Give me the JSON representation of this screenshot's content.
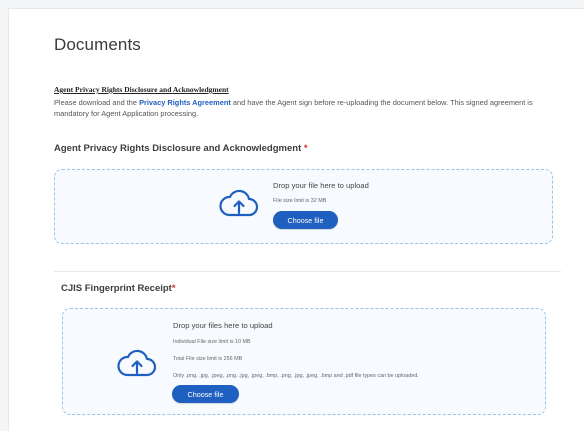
{
  "page": {
    "title": "Documents"
  },
  "disclosure": {
    "heading": "Agent Privacy Rights Disclosure and Acknowledgment",
    "desc_before": "Please download and the ",
    "desc_link": "Privacy Rights Agreement",
    "desc_after": " and have the Agent sign before re-uploading the document below. This signed agreement is mandatory for Agent Application processing."
  },
  "privacy_upload": {
    "label": "Agent Privacy Rights Disclosure and Acknowledgment",
    "required_mark": "*",
    "drop_text": "Drop your file here to upload",
    "limit_text": "File size limit is 32 MB",
    "button_label": "Choose file"
  },
  "cjis_upload": {
    "label": "CJIS Fingerprint Receipt",
    "required_mark": "*",
    "drop_text": "Drop your files here to upload",
    "individual_limit": "Individual File size limit is 10 MB",
    "total_limit": "Total File size limit is 256 MB",
    "types_note": "Only .png, .jpg, .jpeg, .png, .jpg, .jpeg, .bmp, .png, .jpg, .jpeg, .bmp and .pdf file types can be uploaded.",
    "button_label": "Choose file"
  },
  "colors": {
    "accent": "#1f5fbf",
    "required": "#d0333a",
    "dropzone_border": "#9cc3e6"
  },
  "icons": {
    "upload": "cloud-upload-icon"
  }
}
